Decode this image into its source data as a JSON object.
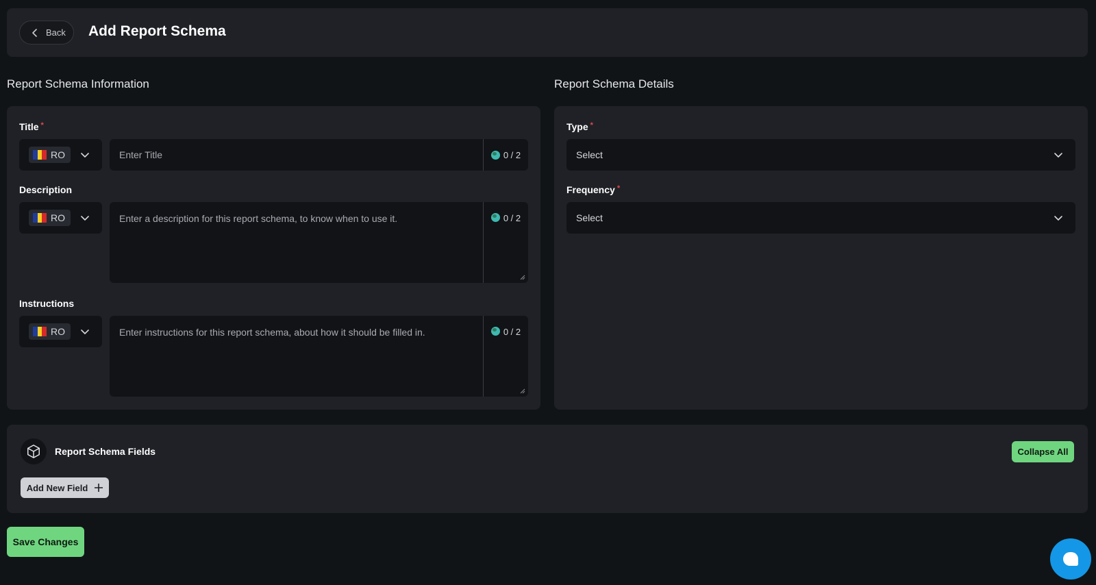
{
  "header": {
    "back_label": "Back",
    "title": "Add Report Schema"
  },
  "info_section": {
    "heading": "Report Schema Information",
    "title_field": {
      "label": "Title",
      "required_mark": "*",
      "lang": "RO",
      "placeholder": "Enter Title",
      "counter": "0 / 2"
    },
    "description_field": {
      "label": "Description",
      "lang": "RO",
      "placeholder": "Enter a description for this report schema, to know when to use it.",
      "counter": "0 / 2"
    },
    "instructions_field": {
      "label": "Instructions",
      "lang": "RO",
      "placeholder": "Enter instructions for this report schema, about how it should be filled in.",
      "counter": "0 / 2"
    }
  },
  "details_section": {
    "heading": "Report Schema Details",
    "type_field": {
      "label": "Type",
      "required_mark": "*",
      "value": "Select"
    },
    "frequency_field": {
      "label": "Frequency",
      "required_mark": "*",
      "value": "Select"
    }
  },
  "fields_section": {
    "title": "Report Schema Fields",
    "collapse_label": "Collapse All",
    "add_label": "Add New Field"
  },
  "footer": {
    "save_label": "Save Changes"
  },
  "colors": {
    "background": "#111417",
    "card": "#1f2126",
    "input": "#111317",
    "accent_green": "#6fd67f",
    "chat_blue": "#1497e6",
    "required_red": "#e5484d"
  },
  "icons": {
    "back": "chevron-left-icon",
    "flag": "romania-flag-icon",
    "dropdown": "chevron-down-icon",
    "counter": "globe-icon",
    "fields": "cube-icon",
    "add": "plus-icon",
    "chat": "chat-icon"
  }
}
